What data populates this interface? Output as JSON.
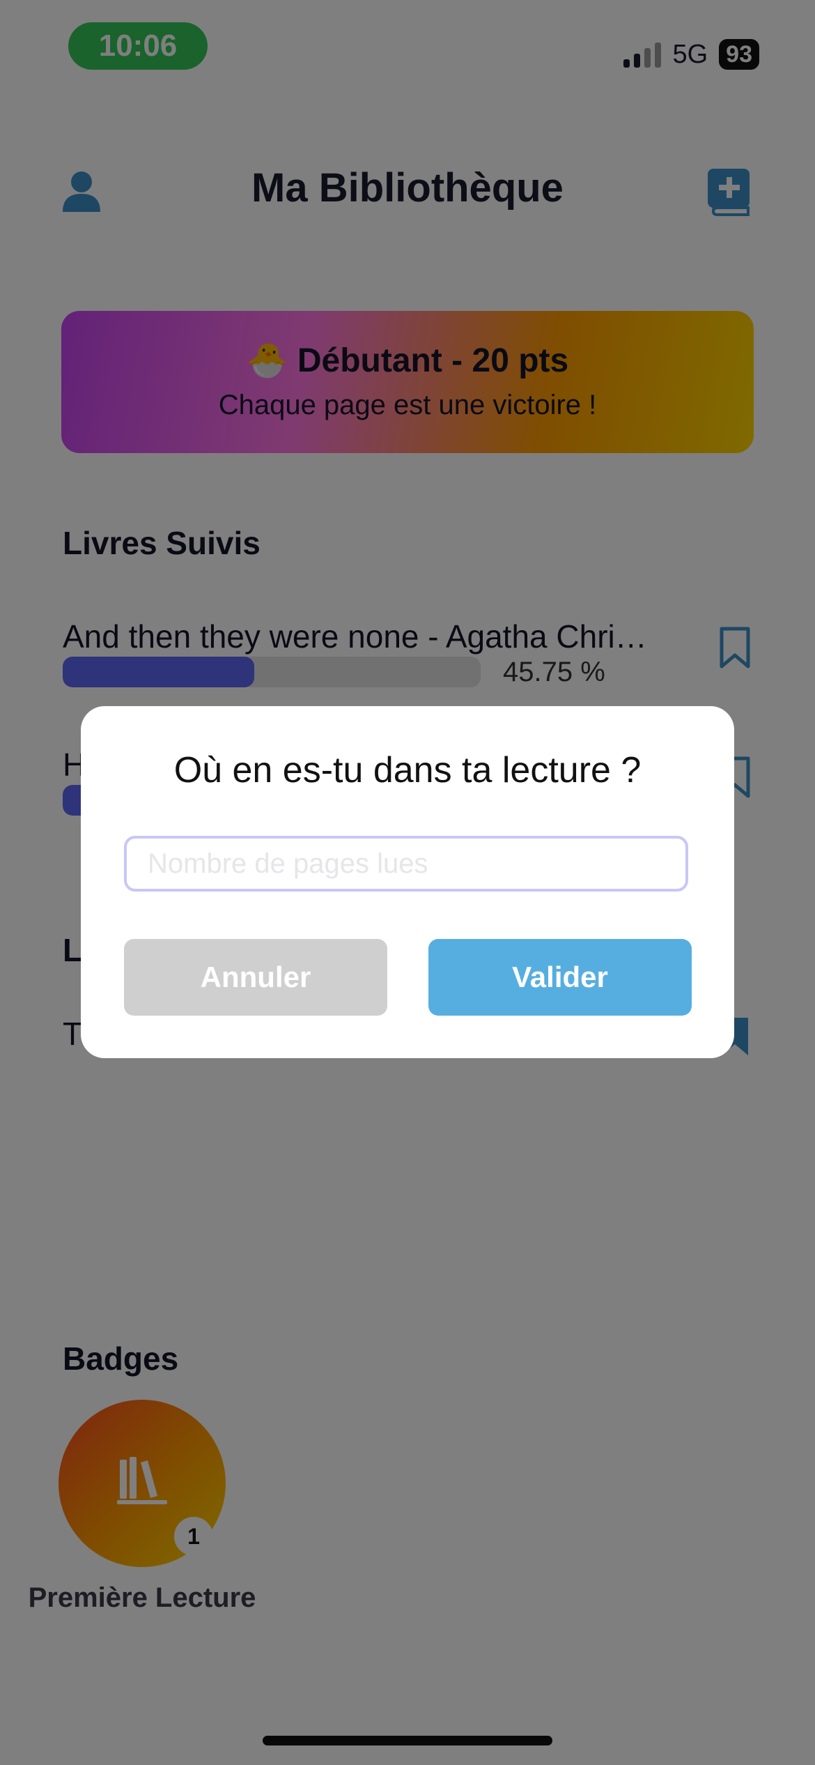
{
  "status_bar": {
    "time": "10:06",
    "network": "5G",
    "battery": "93"
  },
  "header": {
    "title": "Ma Bibliothèque",
    "profile_icon": "user-icon",
    "add_icon": "book-plus-icon"
  },
  "level": {
    "emoji": "🐣",
    "title": "Débutant - 20 pts",
    "subtitle": "Chaque page est une victoire !"
  },
  "followed": {
    "title": "Livres Suivis",
    "books": [
      {
        "title": "And then they were none - Agatha Chri…",
        "percent_text": "45.75 %",
        "progress": 0.4575
      },
      {
        "title": "H",
        "progress": 0.12
      }
    ]
  },
  "second_section": {
    "title": "L",
    "books": [
      {
        "title": "T"
      }
    ]
  },
  "badges": {
    "title": "Badges",
    "items": [
      {
        "name": "Première Lecture",
        "count": "1",
        "icon": "books-icon"
      }
    ]
  },
  "modal": {
    "title": "Où en es-tu dans ta lecture ?",
    "input_placeholder": "Nombre de pages lues",
    "input_value": "",
    "cancel_label": "Annuler",
    "confirm_label": "Valider"
  },
  "colors": {
    "accent_blue": "#56aee0",
    "progress": "#5d66f5",
    "status_green": "#34c759",
    "icon_blue": "#3d8fc6"
  }
}
